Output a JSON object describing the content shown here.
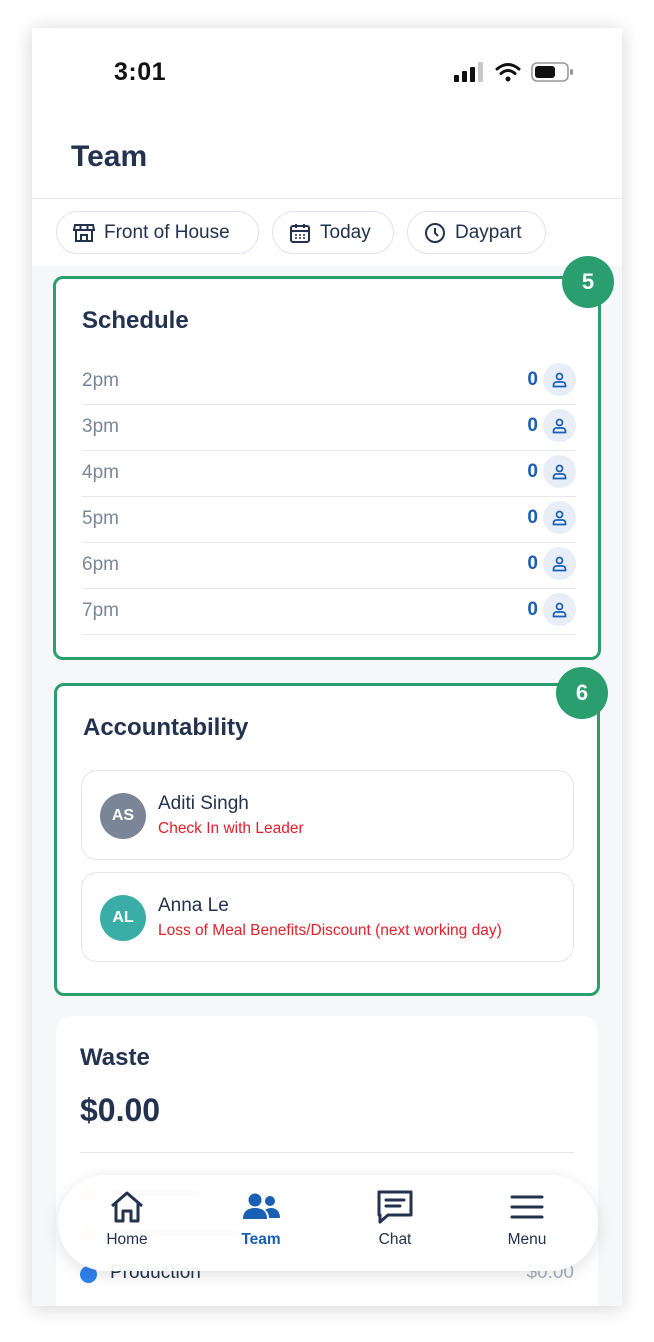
{
  "status_bar": {
    "time": "3:01"
  },
  "header": {
    "title": "Team"
  },
  "filters": {
    "location": "Front of House",
    "date": "Today",
    "daypart": "Daypart"
  },
  "schedule": {
    "badge": "5",
    "title": "Schedule",
    "rows": [
      {
        "time": "2pm",
        "count": "0"
      },
      {
        "time": "3pm",
        "count": "0"
      },
      {
        "time": "4pm",
        "count": "0"
      },
      {
        "time": "5pm",
        "count": "0"
      },
      {
        "time": "6pm",
        "count": "0"
      },
      {
        "time": "7pm",
        "count": "0"
      }
    ]
  },
  "accountability": {
    "badge": "6",
    "title": "Accountability",
    "items": [
      {
        "initials": "AS",
        "name": "Aditi Singh",
        "note": "Check In with Leader",
        "avatar_color": "#7a8598"
      },
      {
        "initials": "AL",
        "name": "Anna Le",
        "note": "Loss of Meal Benefits/Discount (next working day)",
        "avatar_color": "#3aaea6"
      }
    ]
  },
  "waste": {
    "title": "Waste",
    "total": "$0.00",
    "legend": [
      {
        "label": "Production",
        "value": "$0.00",
        "color": "#2f80ed"
      }
    ]
  },
  "bottom_nav": {
    "items": [
      {
        "label": "Home",
        "icon": "home-icon",
        "active": false
      },
      {
        "label": "Team",
        "icon": "team-icon",
        "active": true
      },
      {
        "label": "Chat",
        "icon": "chat-icon",
        "active": false
      },
      {
        "label": "Menu",
        "icon": "menu-icon",
        "active": false
      }
    ]
  },
  "colors": {
    "accent": "#1a5fb4",
    "highlight_outline": "#2a9e6f",
    "alert_text": "#e2202b",
    "heading": "#22324f"
  }
}
